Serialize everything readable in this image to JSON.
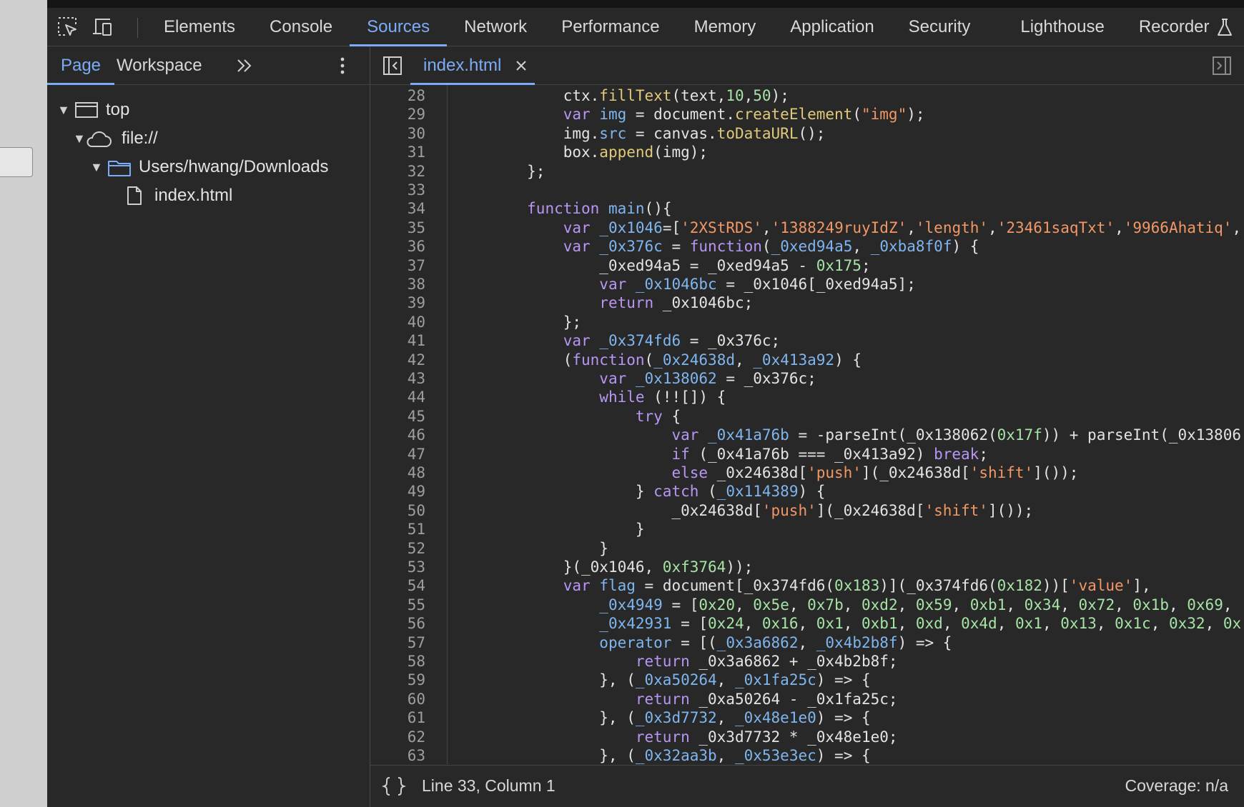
{
  "toolbar": {
    "tabs": [
      {
        "label": "Elements"
      },
      {
        "label": "Console"
      },
      {
        "label": "Sources",
        "active": true
      },
      {
        "label": "Network"
      },
      {
        "label": "Performance"
      },
      {
        "label": "Memory"
      },
      {
        "label": "Application"
      },
      {
        "label": "Security"
      },
      {
        "label": "Lighthouse"
      },
      {
        "label": "Recorder"
      }
    ]
  },
  "navigator": {
    "tabs": [
      "Page",
      "Workspace"
    ],
    "tree": [
      {
        "label": "top",
        "icon": "frame-icon"
      },
      {
        "label": "file://",
        "icon": "cloud-icon"
      },
      {
        "label": "Users/hwang/Downloads",
        "icon": "folder-icon"
      },
      {
        "label": "index.html",
        "icon": "file-icon"
      }
    ]
  },
  "editor": {
    "file_tab": "index.html",
    "status": {
      "cursor": "Line 33, Column 1",
      "coverage": "Coverage: n/a"
    },
    "lines": [
      {
        "n": 28,
        "t": [
          [
            "            ctx.",
            "plain"
          ],
          [
            "fillText",
            "fn"
          ],
          [
            "(text,",
            "plain"
          ],
          [
            "10",
            "num"
          ],
          [
            ",",
            "plain"
          ],
          [
            "50",
            "num"
          ],
          [
            ");",
            "plain"
          ]
        ]
      },
      {
        "n": 29,
        "t": [
          [
            "            ",
            "plain"
          ],
          [
            "var",
            "kw"
          ],
          [
            " ",
            "plain"
          ],
          [
            "img",
            "def"
          ],
          [
            " = document.",
            "plain"
          ],
          [
            "createElement",
            "fn"
          ],
          [
            "(",
            "plain"
          ],
          [
            "\"img\"",
            "str"
          ],
          [
            ");",
            "plain"
          ]
        ]
      },
      {
        "n": 30,
        "t": [
          [
            "            img.",
            "plain"
          ],
          [
            "src",
            "prop"
          ],
          [
            " = canvas.",
            "plain"
          ],
          [
            "toDataURL",
            "fn"
          ],
          [
            "();",
            "plain"
          ]
        ]
      },
      {
        "n": 31,
        "t": [
          [
            "            box.",
            "plain"
          ],
          [
            "append",
            "fn"
          ],
          [
            "(img);",
            "plain"
          ]
        ]
      },
      {
        "n": 32,
        "t": [
          [
            "        };",
            "plain"
          ]
        ]
      },
      {
        "n": 33,
        "t": [
          [
            "",
            "plain"
          ]
        ]
      },
      {
        "n": 34,
        "t": [
          [
            "        ",
            "plain"
          ],
          [
            "function",
            "kw"
          ],
          [
            " ",
            "plain"
          ],
          [
            "main",
            "def"
          ],
          [
            "(){",
            "plain"
          ]
        ]
      },
      {
        "n": 35,
        "t": [
          [
            "            ",
            "plain"
          ],
          [
            "var",
            "kw"
          ],
          [
            " ",
            "plain"
          ],
          [
            "_0x1046",
            "def"
          ],
          [
            "=[",
            "plain"
          ],
          [
            "'2XStRDS'",
            "str"
          ],
          [
            ",",
            "plain"
          ],
          [
            "'1388249ruyIdZ'",
            "str"
          ],
          [
            ",",
            "plain"
          ],
          [
            "'length'",
            "str"
          ],
          [
            ",",
            "plain"
          ],
          [
            "'23461saqTxt'",
            "str"
          ],
          [
            ",",
            "plain"
          ],
          [
            "'9966Ahatiq'",
            "str"
          ],
          [
            ",",
            "plain"
          ]
        ]
      },
      {
        "n": 36,
        "t": [
          [
            "            ",
            "plain"
          ],
          [
            "var",
            "kw"
          ],
          [
            " ",
            "plain"
          ],
          [
            "_0x376c",
            "def"
          ],
          [
            " = ",
            "plain"
          ],
          [
            "function",
            "kw"
          ],
          [
            "(",
            "plain"
          ],
          [
            "_0xed94a5",
            "def"
          ],
          [
            ", ",
            "plain"
          ],
          [
            "_0xba8f0f",
            "def"
          ],
          [
            ") {",
            "plain"
          ]
        ]
      },
      {
        "n": 37,
        "t": [
          [
            "                _0xed94a5 = _0xed94a5 - ",
            "plain"
          ],
          [
            "0x175",
            "num"
          ],
          [
            ";",
            "plain"
          ]
        ]
      },
      {
        "n": 38,
        "t": [
          [
            "                ",
            "plain"
          ],
          [
            "var",
            "kw"
          ],
          [
            " ",
            "plain"
          ],
          [
            "_0x1046bc",
            "def"
          ],
          [
            " = _0x1046[_0xed94a5];",
            "plain"
          ]
        ]
      },
      {
        "n": 39,
        "t": [
          [
            "                ",
            "plain"
          ],
          [
            "return",
            "kw"
          ],
          [
            " _0x1046bc;",
            "plain"
          ]
        ]
      },
      {
        "n": 40,
        "t": [
          [
            "            };",
            "plain"
          ]
        ]
      },
      {
        "n": 41,
        "t": [
          [
            "            ",
            "plain"
          ],
          [
            "var",
            "kw"
          ],
          [
            " ",
            "plain"
          ],
          [
            "_0x374fd6",
            "def"
          ],
          [
            " = _0x376c;",
            "plain"
          ]
        ]
      },
      {
        "n": 42,
        "t": [
          [
            "            (",
            "plain"
          ],
          [
            "function",
            "kw"
          ],
          [
            "(",
            "plain"
          ],
          [
            "_0x24638d",
            "def"
          ],
          [
            ", ",
            "plain"
          ],
          [
            "_0x413a92",
            "def"
          ],
          [
            ") {",
            "plain"
          ]
        ]
      },
      {
        "n": 43,
        "t": [
          [
            "                ",
            "plain"
          ],
          [
            "var",
            "kw"
          ],
          [
            " ",
            "plain"
          ],
          [
            "_0x138062",
            "def"
          ],
          [
            " = _0x376c;",
            "plain"
          ]
        ]
      },
      {
        "n": 44,
        "t": [
          [
            "                ",
            "plain"
          ],
          [
            "while",
            "kw"
          ],
          [
            " (!![]) {",
            "plain"
          ]
        ]
      },
      {
        "n": 45,
        "t": [
          [
            "                    ",
            "plain"
          ],
          [
            "try",
            "kw"
          ],
          [
            " {",
            "plain"
          ]
        ]
      },
      {
        "n": 46,
        "t": [
          [
            "                        ",
            "plain"
          ],
          [
            "var",
            "kw"
          ],
          [
            " ",
            "plain"
          ],
          [
            "_0x41a76b",
            "def"
          ],
          [
            " = -parseInt(_0x138062(",
            "plain"
          ],
          [
            "0x17f",
            "num"
          ],
          [
            ")) + parseInt(_0x13806",
            "plain"
          ]
        ]
      },
      {
        "n": 47,
        "t": [
          [
            "                        ",
            "plain"
          ],
          [
            "if",
            "kw"
          ],
          [
            " (_0x41a76b === _0x413a92) ",
            "plain"
          ],
          [
            "break",
            "kw"
          ],
          [
            ";",
            "plain"
          ]
        ]
      },
      {
        "n": 48,
        "t": [
          [
            "                        ",
            "plain"
          ],
          [
            "else",
            "kw"
          ],
          [
            " _0x24638d[",
            "plain"
          ],
          [
            "'push'",
            "str"
          ],
          [
            "](_0x24638d[",
            "plain"
          ],
          [
            "'shift'",
            "str"
          ],
          [
            "]());",
            "plain"
          ]
        ]
      },
      {
        "n": 49,
        "t": [
          [
            "                    } ",
            "plain"
          ],
          [
            "catch",
            "kw"
          ],
          [
            " (",
            "plain"
          ],
          [
            "_0x114389",
            "def"
          ],
          [
            ") {",
            "plain"
          ]
        ]
      },
      {
        "n": 50,
        "t": [
          [
            "                        _0x24638d[",
            "plain"
          ],
          [
            "'push'",
            "str"
          ],
          [
            "](_0x24638d[",
            "plain"
          ],
          [
            "'shift'",
            "str"
          ],
          [
            "]());",
            "plain"
          ]
        ]
      },
      {
        "n": 51,
        "t": [
          [
            "                    }",
            "plain"
          ]
        ]
      },
      {
        "n": 52,
        "t": [
          [
            "                }",
            "plain"
          ]
        ]
      },
      {
        "n": 53,
        "t": [
          [
            "            }(_0x1046, ",
            "plain"
          ],
          [
            "0xf3764",
            "num"
          ],
          [
            "));",
            "plain"
          ]
        ]
      },
      {
        "n": 54,
        "t": [
          [
            "            ",
            "plain"
          ],
          [
            "var",
            "kw"
          ],
          [
            " ",
            "plain"
          ],
          [
            "flag",
            "def"
          ],
          [
            " = document[_0x374fd6(",
            "plain"
          ],
          [
            "0x183",
            "num"
          ],
          [
            ")](_0x374fd6(",
            "plain"
          ],
          [
            "0x182",
            "num"
          ],
          [
            "))[",
            "plain"
          ],
          [
            "'value'",
            "str"
          ],
          [
            "],",
            "plain"
          ]
        ]
      },
      {
        "n": 55,
        "t": [
          [
            "                ",
            "plain"
          ],
          [
            "_0x4949",
            "def"
          ],
          [
            " = [",
            "plain"
          ],
          [
            "0x20",
            "num"
          ],
          [
            ", ",
            "plain"
          ],
          [
            "0x5e",
            "num"
          ],
          [
            ", ",
            "plain"
          ],
          [
            "0x7b",
            "num"
          ],
          [
            ", ",
            "plain"
          ],
          [
            "0xd2",
            "num"
          ],
          [
            ", ",
            "plain"
          ],
          [
            "0x59",
            "num"
          ],
          [
            ", ",
            "plain"
          ],
          [
            "0xb1",
            "num"
          ],
          [
            ", ",
            "plain"
          ],
          [
            "0x34",
            "num"
          ],
          [
            ", ",
            "plain"
          ],
          [
            "0x72",
            "num"
          ],
          [
            ", ",
            "plain"
          ],
          [
            "0x1b",
            "num"
          ],
          [
            ", ",
            "plain"
          ],
          [
            "0x69",
            "num"
          ],
          [
            ",",
            "plain"
          ]
        ]
      },
      {
        "n": 56,
        "t": [
          [
            "                ",
            "plain"
          ],
          [
            "_0x42931",
            "def"
          ],
          [
            " = [",
            "plain"
          ],
          [
            "0x24",
            "num"
          ],
          [
            ", ",
            "plain"
          ],
          [
            "0x16",
            "num"
          ],
          [
            ", ",
            "plain"
          ],
          [
            "0x1",
            "num"
          ],
          [
            ", ",
            "plain"
          ],
          [
            "0xb1",
            "num"
          ],
          [
            ", ",
            "plain"
          ],
          [
            "0xd",
            "num"
          ],
          [
            ", ",
            "plain"
          ],
          [
            "0x4d",
            "num"
          ],
          [
            ", ",
            "plain"
          ],
          [
            "0x1",
            "num"
          ],
          [
            ", ",
            "plain"
          ],
          [
            "0x13",
            "num"
          ],
          [
            ", ",
            "plain"
          ],
          [
            "0x1c",
            "num"
          ],
          [
            ", ",
            "plain"
          ],
          [
            "0x32",
            "num"
          ],
          [
            ", ",
            "plain"
          ],
          [
            "0x",
            "num"
          ]
        ]
      },
      {
        "n": 57,
        "t": [
          [
            "                ",
            "plain"
          ],
          [
            "operator",
            "def"
          ],
          [
            " = [(",
            "plain"
          ],
          [
            "_0x3a6862",
            "def"
          ],
          [
            ", ",
            "plain"
          ],
          [
            "_0x4b2b8f",
            "def"
          ],
          [
            ") => {",
            "plain"
          ]
        ]
      },
      {
        "n": 58,
        "t": [
          [
            "                    ",
            "plain"
          ],
          [
            "return",
            "kw"
          ],
          [
            " _0x3a6862 + _0x4b2b8f;",
            "plain"
          ]
        ]
      },
      {
        "n": 59,
        "t": [
          [
            "                }, (",
            "plain"
          ],
          [
            "_0xa50264",
            "def"
          ],
          [
            ", ",
            "plain"
          ],
          [
            "_0x1fa25c",
            "def"
          ],
          [
            ") => {",
            "plain"
          ]
        ]
      },
      {
        "n": 60,
        "t": [
          [
            "                    ",
            "plain"
          ],
          [
            "return",
            "kw"
          ],
          [
            " _0xa50264 - _0x1fa25c;",
            "plain"
          ]
        ]
      },
      {
        "n": 61,
        "t": [
          [
            "                }, (",
            "plain"
          ],
          [
            "_0x3d7732",
            "def"
          ],
          [
            ", ",
            "plain"
          ],
          [
            "_0x48e1e0",
            "def"
          ],
          [
            ") => {",
            "plain"
          ]
        ]
      },
      {
        "n": 62,
        "t": [
          [
            "                    ",
            "plain"
          ],
          [
            "return",
            "kw"
          ],
          [
            " _0x3d7732 * _0x48e1e0;",
            "plain"
          ]
        ]
      },
      {
        "n": 63,
        "t": [
          [
            "                }, (",
            "plain"
          ],
          [
            "_0x32aa3b",
            "def"
          ],
          [
            ", ",
            "plain"
          ],
          [
            "_0x53e3ec",
            "def"
          ],
          [
            ") => {",
            "plain"
          ]
        ]
      }
    ]
  }
}
